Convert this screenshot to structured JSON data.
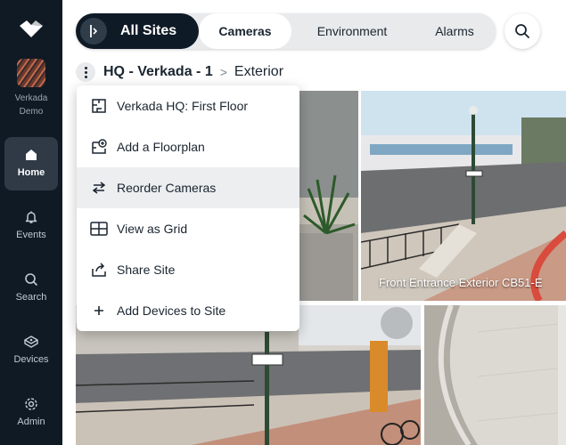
{
  "org": {
    "name_line1": "Verkada",
    "name_line2": "Demo"
  },
  "nav": {
    "home": "Home",
    "events": "Events",
    "search": "Search",
    "devices": "Devices",
    "admin": "Admin"
  },
  "site_selector": {
    "label": "All Sites"
  },
  "tabs": [
    {
      "label": "Cameras",
      "active": true
    },
    {
      "label": "Environment",
      "active": false
    },
    {
      "label": "Alarms",
      "active": false
    }
  ],
  "breadcrumb": {
    "site": "HQ - Verkada - 1",
    "separator": ">",
    "location": "Exterior"
  },
  "menu": [
    {
      "label": "Verkada HQ: First Floor",
      "icon": "floorplan-icon"
    },
    {
      "label": "Add a Floorplan",
      "icon": "add-floorplan-icon"
    },
    {
      "label": "Reorder Cameras",
      "icon": "reorder-arrows-icon",
      "hovered": true
    },
    {
      "label": "View as Grid",
      "icon": "grid-icon"
    },
    {
      "label": "Share Site",
      "icon": "share-icon"
    },
    {
      "label": "Add Devices to Site",
      "icon": "plus-icon"
    }
  ],
  "cameras": [
    {
      "name": ""
    },
    {
      "name": "Front Entrance Exterior CB51-E"
    },
    {
      "name": ""
    },
    {
      "name": ""
    }
  ],
  "colors": {
    "sidebar": "#0f1a24",
    "active_nav": "#2f3a46",
    "site_pill": "#0e1a26",
    "menu_hover": "#eceef0"
  }
}
